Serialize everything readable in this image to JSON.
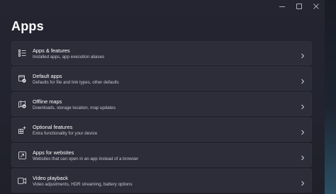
{
  "window": {
    "controls": {
      "minimize": "—",
      "maximize": "☐",
      "close": "✕"
    }
  },
  "page": {
    "title": "Apps"
  },
  "items": [
    {
      "label": "Apps & features",
      "desc": "Installed apps, app execution aliases",
      "icon": "apps-features-icon"
    },
    {
      "label": "Default apps",
      "desc": "Defaults for file and link types, other defaults",
      "icon": "default-apps-icon"
    },
    {
      "label": "Offline maps",
      "desc": "Downloads, storage location, map updates",
      "icon": "offline-maps-icon"
    },
    {
      "label": "Optional features",
      "desc": "Extra functionality for your device",
      "icon": "optional-features-icon"
    },
    {
      "label": "Apps for websites",
      "desc": "Websites that can open in an app instead of a browser",
      "icon": "apps-for-websites-icon"
    },
    {
      "label": "Video playback",
      "desc": "Video adjustments, HDR streaming, battery options",
      "icon": "video-playback-icon"
    }
  ],
  "colors": {
    "background": "#22232e",
    "card": "#2c2d38",
    "text": "#ffffff",
    "subtext": "#c5c6cf"
  }
}
